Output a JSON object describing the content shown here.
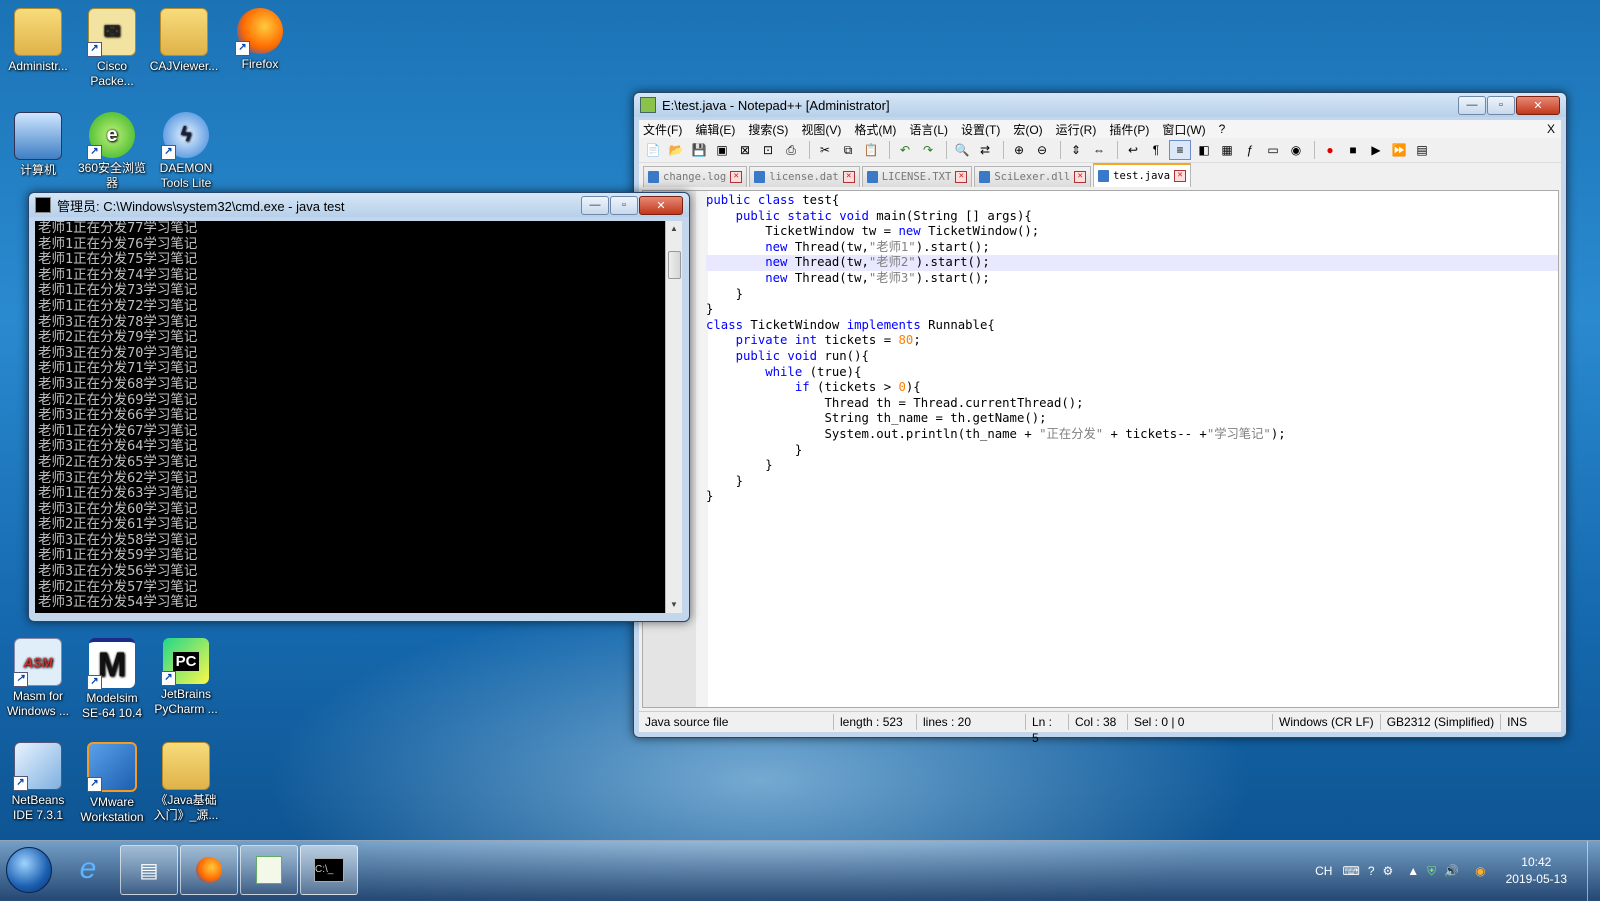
{
  "desktop": {
    "icons": [
      {
        "label1": "Administr...",
        "label2": ""
      },
      {
        "label1": "Cisco",
        "label2": "Packe..."
      },
      {
        "label1": "CAJViewer...",
        "label2": ""
      },
      {
        "label1": "Firefox",
        "label2": ""
      },
      {
        "label1": "计算机",
        "label2": ""
      },
      {
        "label1": "360安全浏览",
        "label2": "器"
      },
      {
        "label1": "DAEMON",
        "label2": "Tools Lite"
      },
      {
        "label1": "Masm for",
        "label2": "Windows ..."
      },
      {
        "label1": "Modelsim",
        "label2": "SE-64 10.4"
      },
      {
        "label1": "JetBrains",
        "label2": "PyCharm ..."
      },
      {
        "label1": "NetBeans",
        "label2": "IDE 7.3.1"
      },
      {
        "label1": "VMware",
        "label2": "Workstation"
      },
      {
        "label1": "《Java基础",
        "label2": "入门》_源..."
      }
    ]
  },
  "cmd": {
    "title": "管理员: C:\\Windows\\system32\\cmd.exe - java  test",
    "lines": [
      "老师1正在分发77学习笔记",
      "老师1正在分发76学习笔记",
      "老师1正在分发75学习笔记",
      "老师1正在分发74学习笔记",
      "老师1正在分发73学习笔记",
      "老师1正在分发72学习笔记",
      "老师3正在分发78学习笔记",
      "老师2正在分发79学习笔记",
      "老师3正在分发70学习笔记",
      "老师1正在分发71学习笔记",
      "老师3正在分发68学习笔记",
      "老师2正在分发69学习笔记",
      "老师3正在分发66学习笔记",
      "老师1正在分发67学习笔记",
      "老师3正在分发64学习笔记",
      "老师2正在分发65学习笔记",
      "老师3正在分发62学习笔记",
      "老师1正在分发63学习笔记",
      "老师3正在分发60学习笔记",
      "老师2正在分发61学习笔记",
      "老师3正在分发58学习笔记",
      "老师1正在分发59学习笔记",
      "老师3正在分发56学习笔记",
      "老师2正在分发57学习笔记",
      "老师3正在分发54学习笔记"
    ]
  },
  "npp": {
    "title": "E:\\test.java - Notepad++ [Administrator]",
    "menu": [
      "文件(F)",
      "编辑(E)",
      "搜索(S)",
      "视图(V)",
      "格式(M)",
      "语言(L)",
      "设置(T)",
      "宏(O)",
      "运行(R)",
      "插件(P)",
      "窗口(W)",
      "?"
    ],
    "menu_close": "X",
    "tabs": [
      "change.log",
      "license.dat",
      "LICENSE.TXT",
      "SciLexer.dll",
      "test.java"
    ],
    "status": {
      "type": "Java source file",
      "length": "length : 523",
      "lines": "lines : 20",
      "ln": "Ln : 5",
      "col": "Col : 38",
      "sel": "Sel : 0 | 0",
      "eol": "Windows (CR LF)",
      "enc": "GB2312 (Simplified)",
      "mode": "INS"
    }
  },
  "code": {
    "l1a": "public class",
    "l1b": " test{",
    "l2a": "    public static void",
    "l2b": " main(String [] args){",
    "l3a": "        TicketWindow tw = ",
    "l3b": "new",
    "l3c": " TicketWindow();",
    "l4a": "        ",
    "l4b": "new",
    "l4c": " Thread(tw,",
    "l4d": "\"老师1\"",
    "l4e": ").start();",
    "l5a": "        ",
    "l5b": "new",
    "l5c": " Thread(tw,",
    "l5d": "\"老师2\"",
    "l5e": ").start();",
    "l6a": "        ",
    "l6b": "new",
    "l6c": " Thread(tw,",
    "l6d": "\"老师3\"",
    "l6e": ").start();",
    "l7": "    }",
    "l8": "}",
    "l9a": "class",
    "l9b": " TicketWindow ",
    "l9c": "implements",
    "l9d": " Runnable{",
    "l10a": "    private int",
    "l10b": " tickets = ",
    "l10c": "80",
    "l10d": ";",
    "l11a": "    public void",
    "l11b": " run(){",
    "l12a": "        while",
    "l12b": " (true){",
    "l13a": "            if",
    "l13b": " (tickets > ",
    "l13c": "0",
    "l13d": "){",
    "l14": "                Thread th = Thread.currentThread();",
    "l15": "                String th_name = th.getName();",
    "l16a": "                System.out.println(th_name + ",
    "l16b": "\"正在分发\"",
    "l16c": " + tickets-- +",
    "l16d": "\"学习笔记\"",
    "l16e": ");",
    "l17": "            }",
    "l18": "        }",
    "l19": "    }",
    "l20": "}"
  },
  "taskbar": {
    "lang": "CH",
    "time": "10:42",
    "date": "2019-05-13"
  },
  "colors": {
    "accent": "#f7a623",
    "keyword": "#0000ff",
    "string": "#808080",
    "number": "#ff8000"
  }
}
